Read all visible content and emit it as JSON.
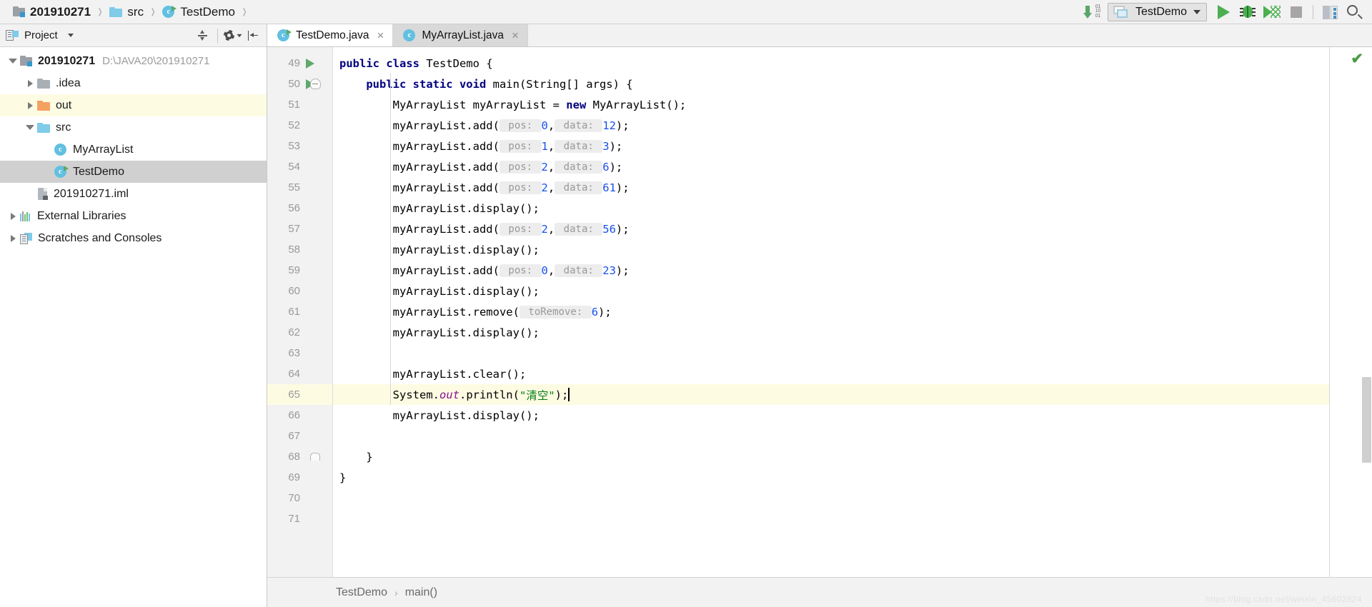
{
  "window": {
    "breadcrumbs": [
      {
        "label": "201910271",
        "icon": "module-icon",
        "bold": true
      },
      {
        "label": "src",
        "icon": "folder-icon",
        "bold": false
      },
      {
        "label": "TestDemo",
        "icon": "java-class-runnable-icon",
        "bold": false
      }
    ],
    "toolbar": {
      "download_icon": "download-binary-icon",
      "run_config_name": "TestDemo",
      "run_label": "Run",
      "debug_label": "Debug",
      "coverage_label": "Run with Coverage",
      "stop_label": "Stop",
      "structure_label": "Structure",
      "search_label": "Search Everywhere"
    }
  },
  "sidebar": {
    "title": "Project",
    "header_actions": [
      "expand-all-icon",
      "settings-gear-icon",
      "collapse-all-icon"
    ],
    "tree": [
      {
        "label": "201910271",
        "sub": "D:\\JAVA20\\201910271",
        "icon": "module-icon",
        "indent": 0,
        "twisty": "open",
        "bold": true,
        "state": "normal"
      },
      {
        "label": ".idea",
        "sub": "",
        "icon": "folder-gray-icon",
        "indent": 1,
        "twisty": "closed",
        "bold": false,
        "state": "normal"
      },
      {
        "label": "out",
        "sub": "",
        "icon": "folder-orange-icon",
        "indent": 1,
        "twisty": "closed",
        "bold": false,
        "state": "highlight"
      },
      {
        "label": "src",
        "sub": "",
        "icon": "folder-blue-icon",
        "indent": 1,
        "twisty": "open",
        "bold": false,
        "state": "normal"
      },
      {
        "label": "MyArrayList",
        "sub": "",
        "icon": "java-class-icon",
        "indent": 2,
        "twisty": "none",
        "bold": false,
        "state": "normal"
      },
      {
        "label": "TestDemo",
        "sub": "",
        "icon": "java-class-runnable-icon",
        "indent": 2,
        "twisty": "none",
        "bold": false,
        "state": "selected"
      },
      {
        "label": "201910271.iml",
        "sub": "",
        "icon": "iml-file-icon",
        "indent": 1,
        "twisty": "none",
        "bold": false,
        "state": "normal"
      },
      {
        "label": "External Libraries",
        "sub": "",
        "icon": "libraries-icon",
        "indent": 0,
        "twisty": "closed",
        "bold": false,
        "state": "normal"
      },
      {
        "label": "Scratches and Consoles",
        "sub": "",
        "icon": "scratches-icon",
        "indent": 0,
        "twisty": "closed",
        "bold": false,
        "state": "normal"
      }
    ]
  },
  "editor": {
    "tabs": [
      {
        "label": "TestDemo.java",
        "icon": "java-class-runnable-icon",
        "active": true,
        "close": "×"
      },
      {
        "label": "MyArrayList.java",
        "icon": "java-class-icon",
        "active": false,
        "close": "×"
      }
    ],
    "first_line": 49,
    "highlight_line": 65,
    "lines": [
      {
        "n": 49,
        "gutter": "run",
        "fold": "fold-open",
        "tokens": [
          {
            "t": "public ",
            "c": "kw"
          },
          {
            "t": "class ",
            "c": "kw"
          },
          {
            "t": "TestDemo {",
            "c": "pl"
          }
        ]
      },
      {
        "n": 50,
        "gutter": "run",
        "fold": "fold-open2",
        "tokens": [
          {
            "t": "    ",
            "c": "pl"
          },
          {
            "t": "public static void ",
            "c": "kw"
          },
          {
            "t": "main(String[] args) {",
            "c": "pl"
          }
        ]
      },
      {
        "n": 51,
        "gutter": "",
        "fold": "",
        "tokens": [
          {
            "t": "        MyArrayList myArrayList = ",
            "c": "pl"
          },
          {
            "t": "new ",
            "c": "kw"
          },
          {
            "t": "MyArrayList();",
            "c": "pl"
          }
        ]
      },
      {
        "n": 52,
        "gutter": "",
        "fold": "",
        "tokens": [
          {
            "t": "        myArrayList.add(",
            "c": "pl"
          },
          {
            "t": " pos: ",
            "c": "hint"
          },
          {
            "t": "0",
            "c": "num"
          },
          {
            "t": ",",
            "c": "pl"
          },
          {
            "t": " data: ",
            "c": "hint"
          },
          {
            "t": "12",
            "c": "num"
          },
          {
            "t": ");",
            "c": "pl"
          }
        ]
      },
      {
        "n": 53,
        "gutter": "",
        "fold": "",
        "tokens": [
          {
            "t": "        myArrayList.add(",
            "c": "pl"
          },
          {
            "t": " pos: ",
            "c": "hint"
          },
          {
            "t": "1",
            "c": "num"
          },
          {
            "t": ",",
            "c": "pl"
          },
          {
            "t": " data: ",
            "c": "hint"
          },
          {
            "t": "3",
            "c": "num"
          },
          {
            "t": ");",
            "c": "pl"
          }
        ]
      },
      {
        "n": 54,
        "gutter": "",
        "fold": "",
        "tokens": [
          {
            "t": "        myArrayList.add(",
            "c": "pl"
          },
          {
            "t": " pos: ",
            "c": "hint"
          },
          {
            "t": "2",
            "c": "num"
          },
          {
            "t": ",",
            "c": "pl"
          },
          {
            "t": " data: ",
            "c": "hint"
          },
          {
            "t": "6",
            "c": "num"
          },
          {
            "t": ");",
            "c": "pl"
          }
        ]
      },
      {
        "n": 55,
        "gutter": "",
        "fold": "",
        "tokens": [
          {
            "t": "        myArrayList.add(",
            "c": "pl"
          },
          {
            "t": " pos: ",
            "c": "hint"
          },
          {
            "t": "2",
            "c": "num"
          },
          {
            "t": ",",
            "c": "pl"
          },
          {
            "t": " data: ",
            "c": "hint"
          },
          {
            "t": "61",
            "c": "num"
          },
          {
            "t": ");",
            "c": "pl"
          }
        ]
      },
      {
        "n": 56,
        "gutter": "",
        "fold": "",
        "tokens": [
          {
            "t": "        myArrayList.display();",
            "c": "pl"
          }
        ]
      },
      {
        "n": 57,
        "gutter": "",
        "fold": "",
        "tokens": [
          {
            "t": "        myArrayList.add(",
            "c": "pl"
          },
          {
            "t": " pos: ",
            "c": "hint"
          },
          {
            "t": "2",
            "c": "num"
          },
          {
            "t": ",",
            "c": "pl"
          },
          {
            "t": " data: ",
            "c": "hint"
          },
          {
            "t": "56",
            "c": "num"
          },
          {
            "t": ");",
            "c": "pl"
          }
        ]
      },
      {
        "n": 58,
        "gutter": "",
        "fold": "",
        "tokens": [
          {
            "t": "        myArrayList.display();",
            "c": "pl"
          }
        ]
      },
      {
        "n": 59,
        "gutter": "",
        "fold": "",
        "tokens": [
          {
            "t": "        myArrayList.add(",
            "c": "pl"
          },
          {
            "t": " pos: ",
            "c": "hint"
          },
          {
            "t": "0",
            "c": "num"
          },
          {
            "t": ",",
            "c": "pl"
          },
          {
            "t": " data: ",
            "c": "hint"
          },
          {
            "t": "23",
            "c": "num"
          },
          {
            "t": ");",
            "c": "pl"
          }
        ]
      },
      {
        "n": 60,
        "gutter": "",
        "fold": "",
        "tokens": [
          {
            "t": "        myArrayList.display();",
            "c": "pl"
          }
        ]
      },
      {
        "n": 61,
        "gutter": "",
        "fold": "",
        "tokens": [
          {
            "t": "        myArrayList.remove(",
            "c": "pl"
          },
          {
            "t": " toRemove: ",
            "c": "hint"
          },
          {
            "t": "6",
            "c": "num"
          },
          {
            "t": ");",
            "c": "pl"
          }
        ]
      },
      {
        "n": 62,
        "gutter": "",
        "fold": "",
        "tokens": [
          {
            "t": "        myArrayList.display();",
            "c": "pl"
          }
        ]
      },
      {
        "n": 63,
        "gutter": "",
        "fold": "",
        "tokens": []
      },
      {
        "n": 64,
        "gutter": "",
        "fold": "",
        "tokens": [
          {
            "t": "        myArrayList.clear();",
            "c": "pl"
          }
        ]
      },
      {
        "n": 65,
        "gutter": "",
        "fold": "",
        "tokens": [
          {
            "t": "        System.",
            "c": "pl"
          },
          {
            "t": "out",
            "c": "fld"
          },
          {
            "t": ".println(",
            "c": "pl"
          },
          {
            "t": "\"清空\"",
            "c": "str"
          },
          {
            "t": ");",
            "c": "pl"
          },
          {
            "t": "CARET",
            "c": "caret"
          }
        ]
      },
      {
        "n": 66,
        "gutter": "",
        "fold": "",
        "tokens": [
          {
            "t": "        myArrayList.display();",
            "c": "pl"
          }
        ]
      },
      {
        "n": 67,
        "gutter": "",
        "fold": "",
        "tokens": []
      },
      {
        "n": 68,
        "gutter": "",
        "fold": "fold-end",
        "tokens": [
          {
            "t": "    }",
            "c": "pl"
          }
        ]
      },
      {
        "n": 69,
        "gutter": "",
        "fold": "",
        "tokens": [
          {
            "t": "}",
            "c": "pl"
          }
        ]
      },
      {
        "n": 70,
        "gutter": "",
        "fold": "",
        "tokens": []
      },
      {
        "n": 71,
        "gutter": "",
        "fold": "",
        "tokens": []
      }
    ],
    "inspection_status": "✔",
    "bottom_breadcrumb": [
      "TestDemo",
      "main()"
    ],
    "breadcrumb_separator": "›",
    "watermark": "https://blog.csdn.net/weixin_45602824"
  },
  "colors": {
    "keyword": "#000080",
    "number": "#1750eb",
    "string": "#067d17",
    "field": "#871094",
    "hint_bg": "#ededed",
    "highlight_row": "#fdfce3",
    "selection": "#d0d0d0",
    "accent_green": "#4caf50"
  }
}
